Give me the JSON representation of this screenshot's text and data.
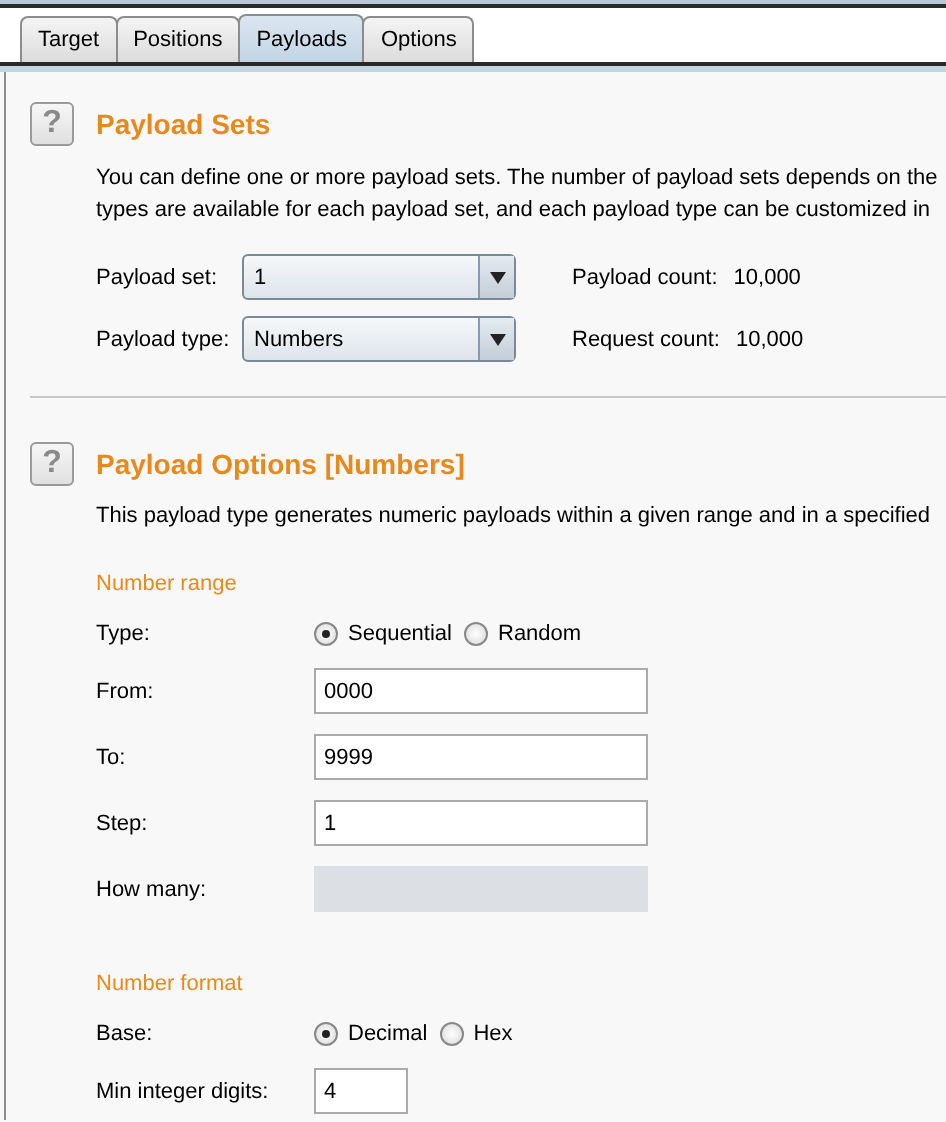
{
  "tabs": [
    {
      "label": "Target",
      "selected": false
    },
    {
      "label": "Positions",
      "selected": false
    },
    {
      "label": "Payloads",
      "selected": true
    },
    {
      "label": "Options",
      "selected": false
    }
  ],
  "payload_sets": {
    "help_icon": "?",
    "title": "Payload Sets",
    "description_lines": [
      "You can define one or more payload sets. The number of payload sets depends on the",
      "types are available for each payload set, and each payload type can be customized in"
    ],
    "rows": [
      {
        "label": "Payload set:",
        "value": "1",
        "info_label": "Payload count:",
        "info_value": "10,000"
      },
      {
        "label": "Payload type:",
        "value": "Numbers",
        "info_label": "Request count:",
        "info_value": "10,000"
      }
    ]
  },
  "payload_options": {
    "help_icon": "?",
    "title": "Payload Options [Numbers]",
    "description": "This payload type generates numeric payloads within a given range and in a specified",
    "groups": [
      {
        "title": "Number range",
        "rows": [
          {
            "kind": "radio",
            "label": "Type:",
            "options": [
              {
                "label": "Sequential",
                "selected": true
              },
              {
                "label": "Random",
                "selected": false
              }
            ]
          },
          {
            "kind": "field",
            "label": "From:",
            "value": "0000",
            "disabled": false
          },
          {
            "kind": "field",
            "label": "To:",
            "value": "9999",
            "disabled": false
          },
          {
            "kind": "field",
            "label": "Step:",
            "value": "1",
            "disabled": false
          },
          {
            "kind": "field",
            "label": "How many:",
            "disabled": true
          }
        ]
      },
      {
        "title": "Number format",
        "rows": [
          {
            "kind": "radio",
            "label": "Base:",
            "options": [
              {
                "label": "Decimal",
                "selected": true
              },
              {
                "label": "Hex",
                "selected": false
              }
            ]
          },
          {
            "kind": "short-field",
            "label": "Min integer digits:",
            "value": "4",
            "disabled": false
          }
        ]
      }
    ]
  }
}
